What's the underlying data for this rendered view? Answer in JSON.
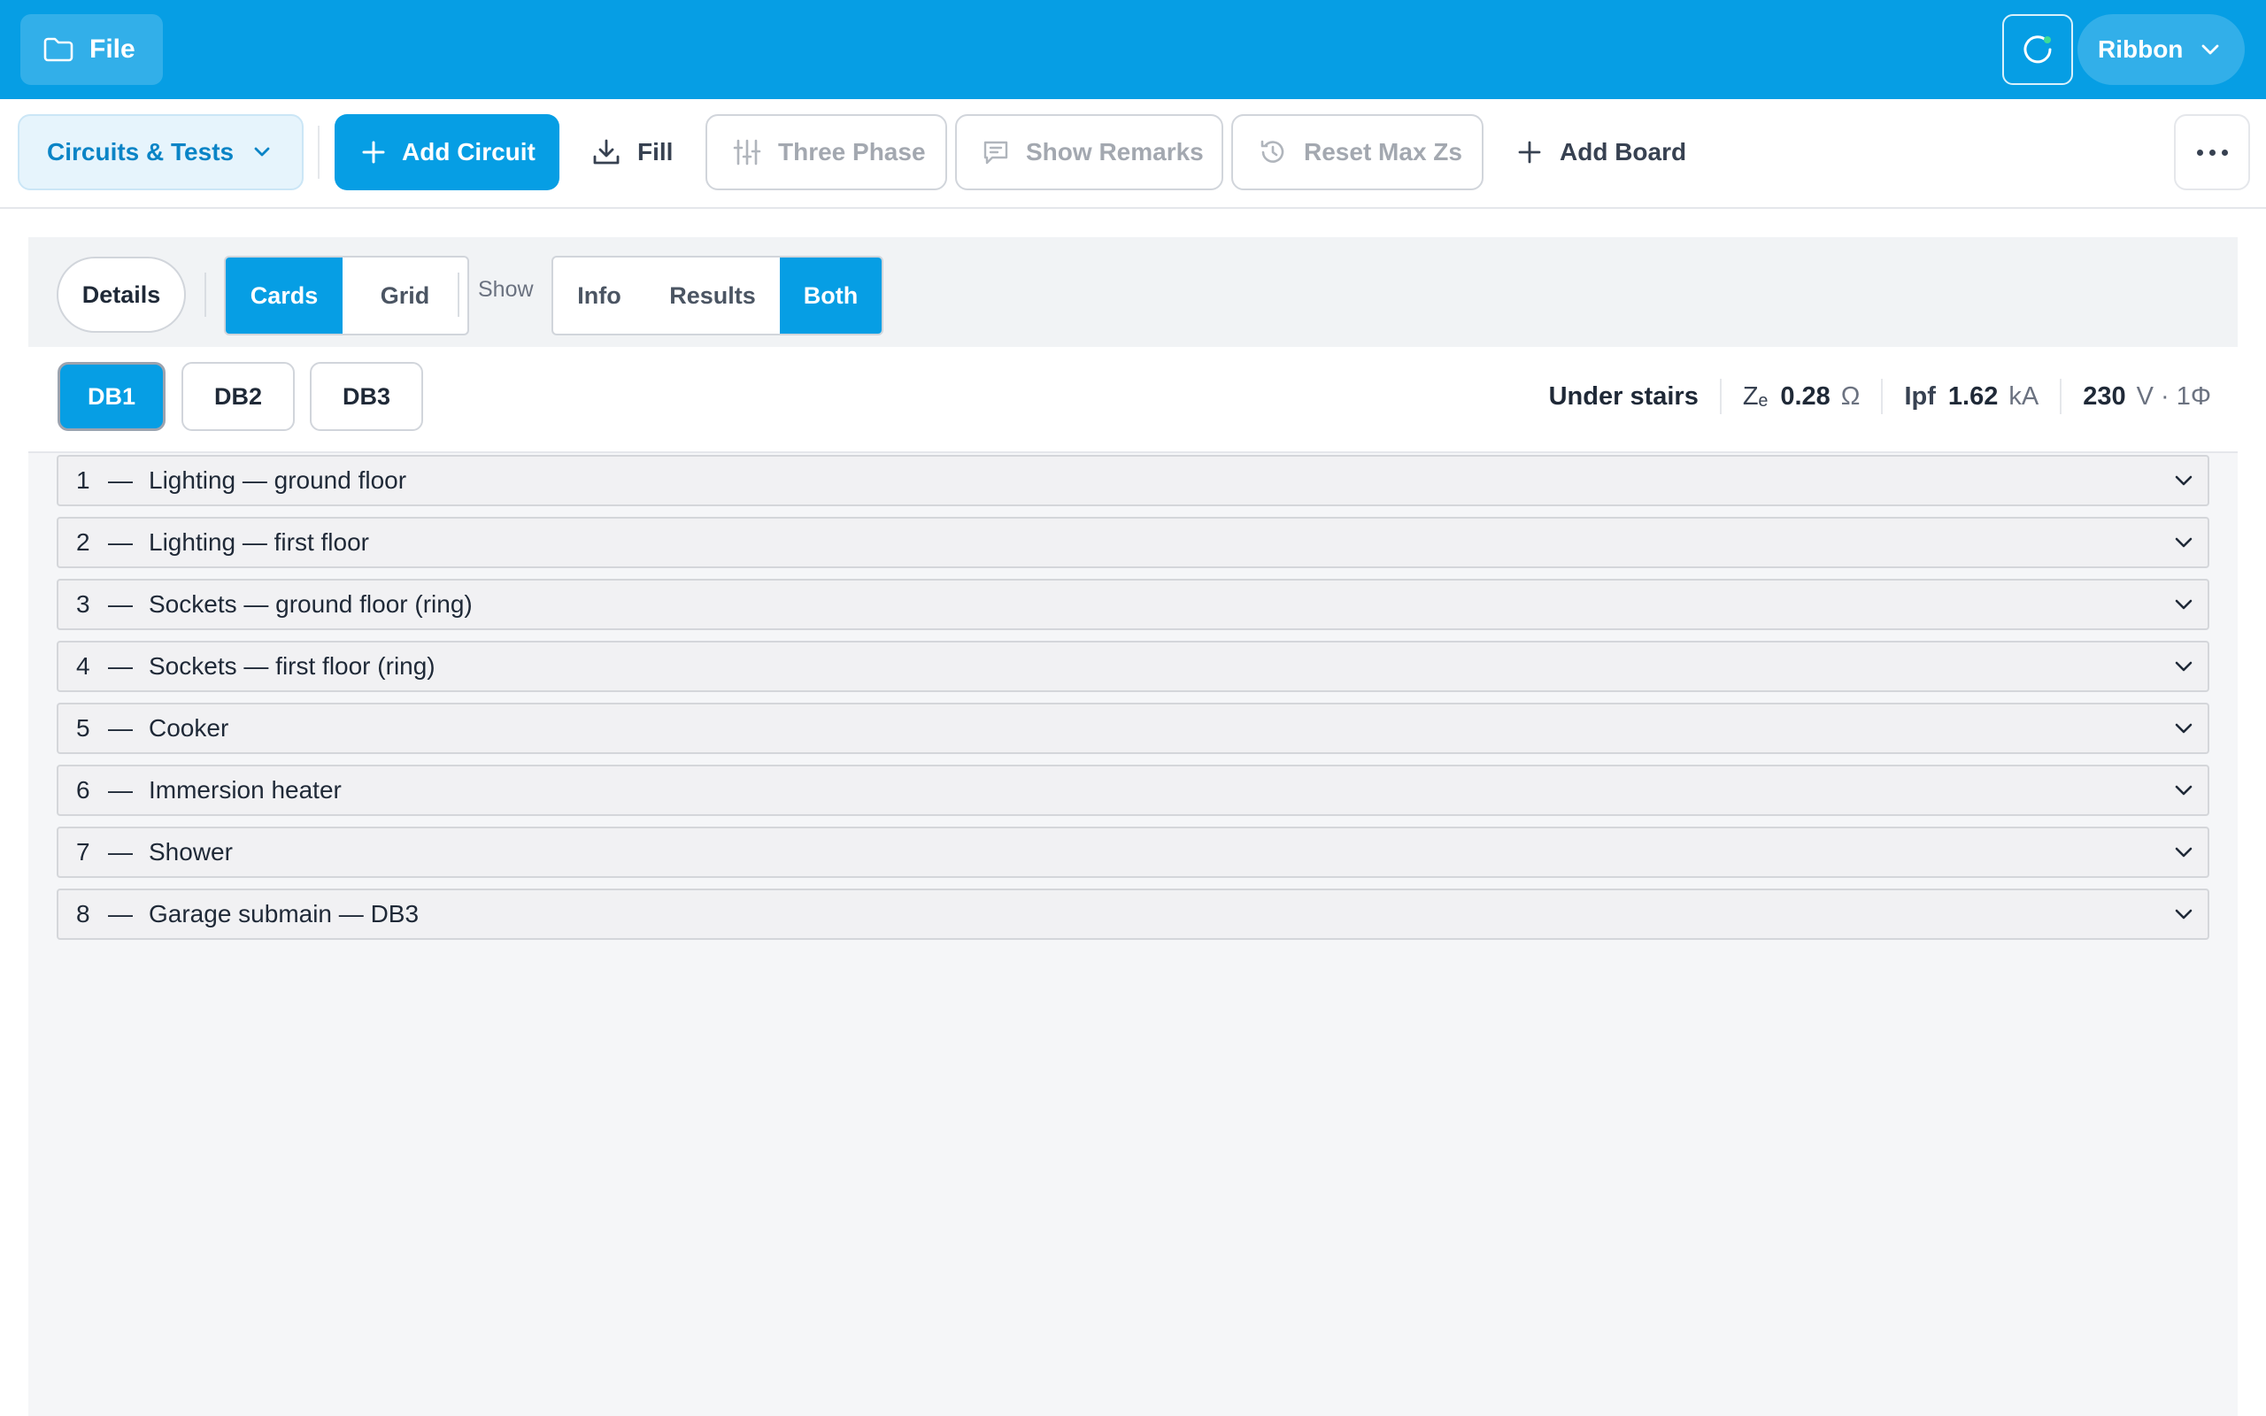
{
  "appbar": {
    "file_label": "File",
    "ribbon_label": "Ribbon",
    "brand_color": "#069ee4",
    "icons": [
      "folder-icon",
      "refresh-icon",
      "chevron-down-icon"
    ]
  },
  "toolbar": {
    "section_label": "Circuits & Tests",
    "add_circuit_label": "Add Circuit",
    "fill_label": "Fill",
    "three_phase_label": "Three Phase",
    "show_remarks_label": "Show Remarks",
    "reset_max_zs_label": "Reset Max Zs",
    "add_board_label": "Add Board",
    "disabled_buttons": [
      "Three Phase",
      "Show Remarks",
      "Reset Max Zs"
    ]
  },
  "view": {
    "details_label": "Details",
    "layout_options": [
      "Cards",
      "Grid"
    ],
    "layout_selected": "Cards",
    "show_label": "Show",
    "show_options": [
      "Info",
      "Results",
      "Both"
    ],
    "show_selected": "Both"
  },
  "boards": {
    "tabs": [
      "DB1",
      "DB2",
      "DB3"
    ],
    "selected": "DB1",
    "location": "Under stairs",
    "ze_label": "Zₑ",
    "ze_value": "0.28",
    "ze_unit": "Ω",
    "ipf_label": "Ipf",
    "ipf_value": "1.62",
    "ipf_unit": "kA",
    "voltage_value": "230",
    "voltage_unit": "V · 1Φ"
  },
  "circuits": [
    {
      "num": "1",
      "sep": "—",
      "name": "Lighting — ground floor"
    },
    {
      "num": "2",
      "sep": "—",
      "name": "Lighting — first floor"
    },
    {
      "num": "3",
      "sep": "—",
      "name": "Sockets — ground floor (ring)"
    },
    {
      "num": "4",
      "sep": "—",
      "name": "Sockets — first floor (ring)"
    },
    {
      "num": "5",
      "sep": "—",
      "name": "Cooker"
    },
    {
      "num": "6",
      "sep": "—",
      "name": "Immersion heater"
    },
    {
      "num": "7",
      "sep": "—",
      "name": "Shower"
    },
    {
      "num": "8",
      "sep": "—",
      "name": "Garage submain — DB3"
    }
  ]
}
